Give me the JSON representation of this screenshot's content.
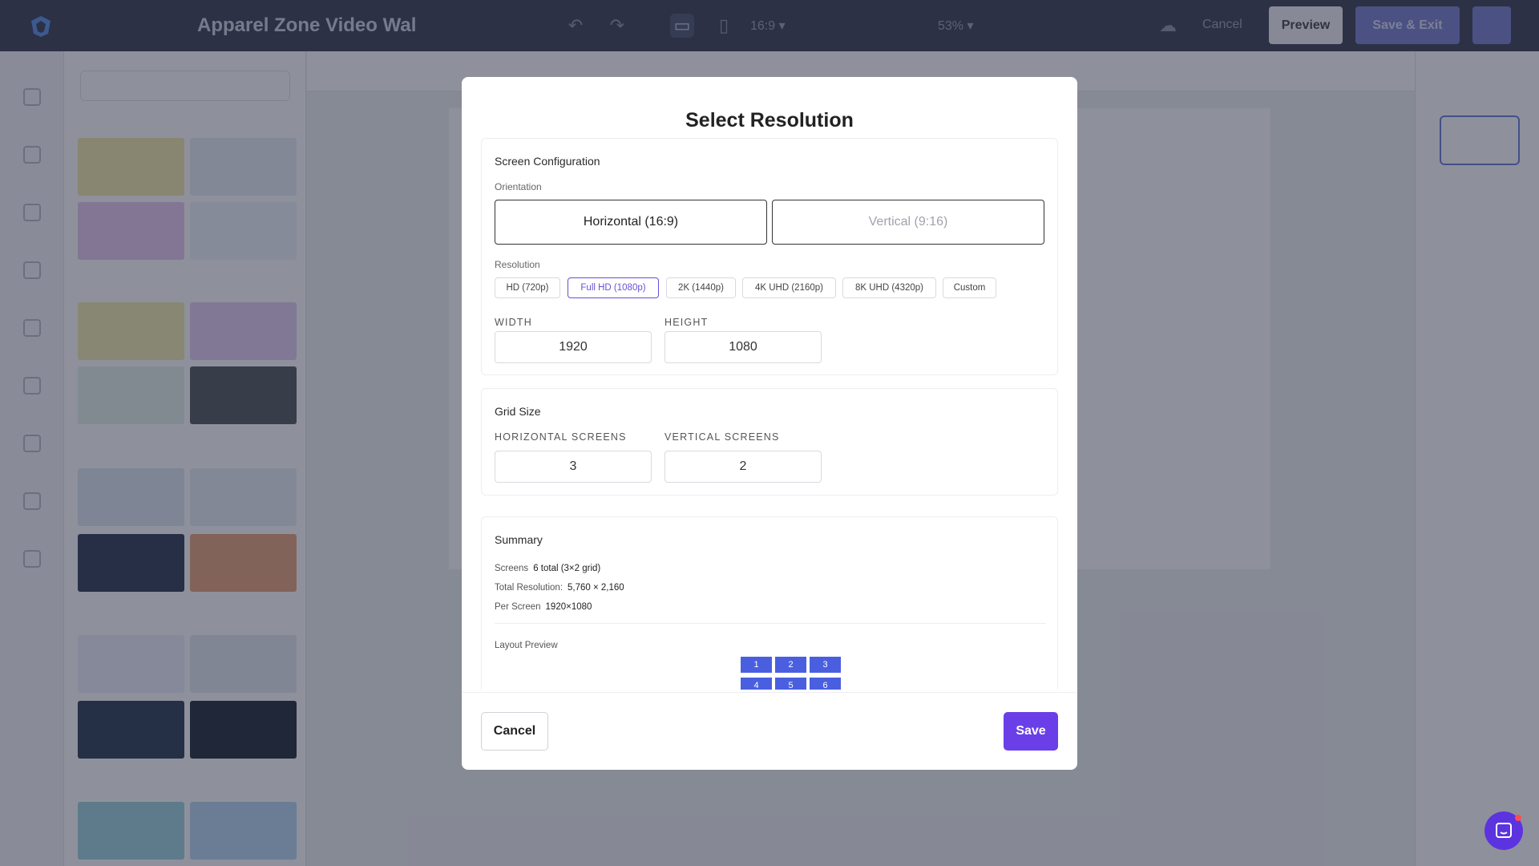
{
  "app": {
    "document_title": "Apparel Zone Video Wal",
    "aspect_label": "16:9",
    "zoom_label": "53%",
    "cancel_label": "Cancel",
    "preview_label": "Preview",
    "save_exit_label": "Save & Exit"
  },
  "modal": {
    "title": "Select Resolution",
    "screen_configuration": {
      "title": "Screen Configuration",
      "orientation_label": "Orientation",
      "orientations": [
        {
          "label": "Horizontal (16:9)",
          "selected": true
        },
        {
          "label": "Vertical (9:16)",
          "selected": false
        }
      ],
      "resolution_label": "Resolution",
      "resolutions": [
        {
          "label": "HD (720p)",
          "selected": false
        },
        {
          "label": "Full HD (1080p)",
          "selected": true
        },
        {
          "label": "2K (1440p)",
          "selected": false
        },
        {
          "label": "4K UHD (2160p)",
          "selected": false
        },
        {
          "label": "8K UHD (4320p)",
          "selected": false
        },
        {
          "label": "Custom",
          "selected": false
        }
      ],
      "width_label": "WIDTH",
      "width_value": "1920",
      "height_label": "HEIGHT",
      "height_value": "1080"
    },
    "grid_size": {
      "title": "Grid Size",
      "horizontal_label": "HORIZONTAL SCREENS",
      "horizontal_value": "3",
      "vertical_label": "VERTICAL SCREENS",
      "vertical_value": "2"
    },
    "summary": {
      "title": "Summary",
      "screens_label": "Screens",
      "screens_value": "6 total (3×2 grid)",
      "total_label": "Total Resolution:",
      "total_value": "5,760 × 2,160",
      "per_screen_label": "Per Screen",
      "per_screen_value": "1920×1080",
      "layout_preview_label": "Layout Preview",
      "cells": [
        "1",
        "2",
        "3",
        "4",
        "5",
        "6"
      ]
    },
    "footer": {
      "cancel_label": "Cancel",
      "save_label": "Save"
    }
  },
  "colors": {
    "accent": "#6a3fe8",
    "grid_cell": "#4a5fe0",
    "topbar": "#3a3f55"
  }
}
